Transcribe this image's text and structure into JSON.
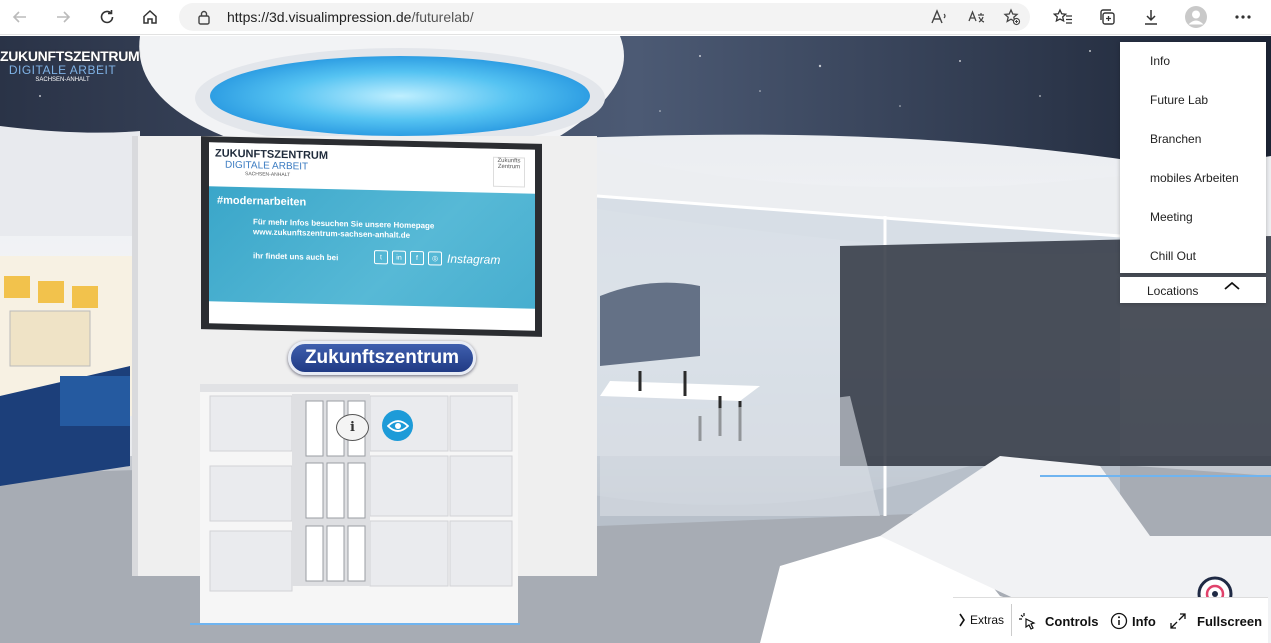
{
  "browser": {
    "url_host": "https://3d.visualimpression.de",
    "url_path": "/futurelab/"
  },
  "scene": {
    "brand": {
      "line1": "ZUKUNFTSZENTRUM",
      "line2": "DIGITALE ARBEIT",
      "line3": "SACHSEN-ANHALT"
    },
    "tv": {
      "logo_line1": "ZUKUNFTSZENTRUM",
      "logo_line2": "DIGITALE ARBEIT",
      "logo_line3": "SACHSEN-ANHALT",
      "badge": "Zukunfts Zentrum",
      "hashtag": "#modernarbeiten",
      "info_line1": "Für mehr Infos besuchen Sie unsere Homepage",
      "info_line2": "www.zukunftszentrum-sachsen-anhalt.de",
      "social_text": "ihr findet uns auch bei",
      "instagram": "Instagram"
    },
    "sign": "Zukunftszentrum",
    "info_hotspot": "i"
  },
  "locations_menu": {
    "items": [
      "Info",
      "Future Lab",
      "Branchen",
      "mobiles Arbeiten",
      "Meeting",
      "Chill Out"
    ],
    "toggle_label": "Locations"
  },
  "toolbar": {
    "extras": "Extras",
    "controls": "Controls",
    "info": "Info",
    "fullscreen": "Fullscreen"
  },
  "colors": {
    "accent_blue": "#1d9bd8",
    "sign_blue": "#203a84",
    "tv_blue": "#57b9d6"
  }
}
